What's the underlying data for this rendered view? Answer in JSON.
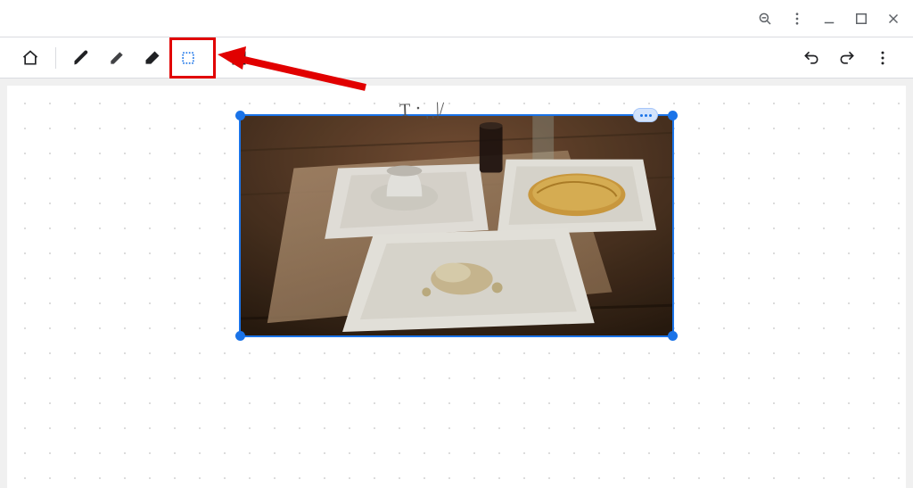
{
  "titlebar": {
    "buttons": {
      "zoom_out": "zoom-out",
      "menu": "kebab-menu",
      "minimize": "minimize",
      "maximize": "maximize",
      "close": "close"
    }
  },
  "toolbar": {
    "tools": {
      "home": "home",
      "pen": "pen",
      "highlighter": "highlighter",
      "eraser": "eraser",
      "select": "select",
      "insert_image": "insert-image"
    },
    "undo": "undo",
    "redo": "redo",
    "more": "more"
  },
  "annotation": {
    "highlight_label": "select-tool-highlight",
    "arrow_label": "pointer-arrow"
  },
  "canvas": {
    "scribble_text": "T᠂ ˌˌ|/",
    "image": {
      "description": "Photograph of a dinner table with two white plates of food (one with an omelette), a white cup on a saucer, a glass of dark beverage, and a vase, on a wooden table with a placemat.",
      "selected": true,
      "more_menu": "image-more-menu"
    }
  },
  "colors": {
    "selection": "#1a73e8",
    "highlight": "#e10000"
  }
}
